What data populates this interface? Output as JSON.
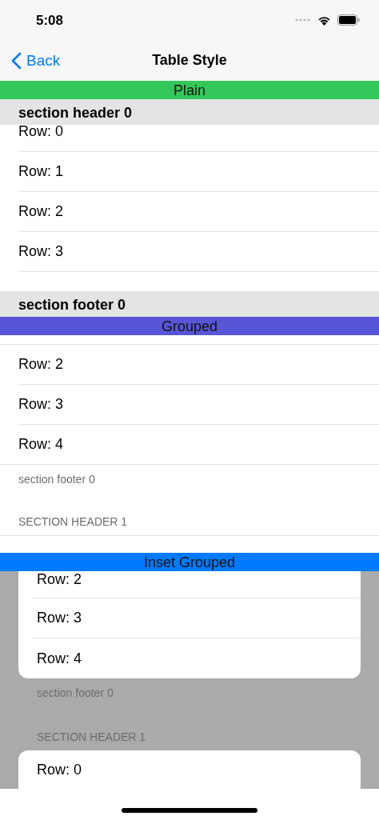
{
  "status_bar": {
    "time": "5:08"
  },
  "nav_bar": {
    "back": "Back",
    "title": "Table Style"
  },
  "tables": [
    {
      "kind": "plain",
      "label": "Plain",
      "color": "#34c759",
      "sections": [
        {
          "header": "section header 0",
          "rows": [
            "Row: 0",
            "Row: 1",
            "Row: 2",
            "Row: 3"
          ],
          "footer": "section footer 0"
        }
      ]
    },
    {
      "kind": "grouped",
      "label": "Grouped",
      "color": "#5856d6",
      "sections": [
        {
          "rows": [
            "Row: 2",
            "Row: 3",
            "Row: 4"
          ],
          "footer": "section footer 0"
        },
        {
          "header": "SECTION HEADER 1"
        }
      ]
    },
    {
      "kind": "inset_grouped",
      "label": "Inset Grouped",
      "color": "#007aff",
      "sections": [
        {
          "rows": [
            "Row: 2",
            "Row: 3",
            "Row: 4"
          ],
          "footer": "section footer 0"
        },
        {
          "header": "SECTION HEADER 1",
          "rows": [
            "Row: 0"
          ]
        }
      ]
    }
  ]
}
